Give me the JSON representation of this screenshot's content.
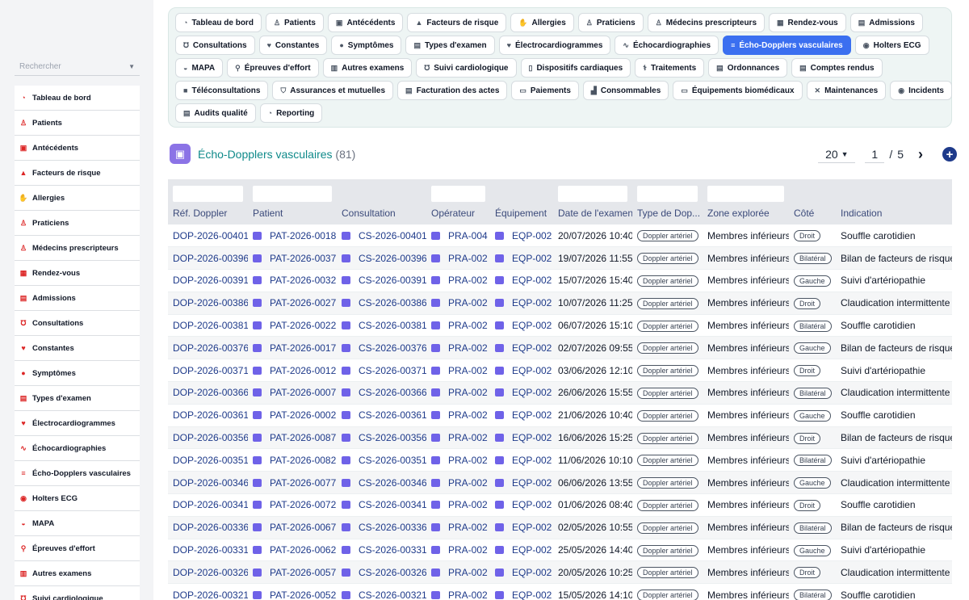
{
  "sidebar": {
    "search_placeholder": "Rechercher",
    "items": [
      {
        "label": "Tableau de bord",
        "icon": "dashboard-icon",
        "glyph": "◔"
      },
      {
        "label": "Patients",
        "icon": "patients-icon",
        "glyph": "♙"
      },
      {
        "label": "Antécédents",
        "icon": "history-icon",
        "glyph": "▣"
      },
      {
        "label": "Facteurs de risque",
        "icon": "warning-icon",
        "glyph": "▲"
      },
      {
        "label": "Allergies",
        "icon": "hand-icon",
        "glyph": "✋"
      },
      {
        "label": "Praticiens",
        "icon": "doctor-icon",
        "glyph": "♙"
      },
      {
        "label": "Médecins prescripteurs",
        "icon": "prescriber-icon",
        "glyph": "♙"
      },
      {
        "label": "Rendez-vous",
        "icon": "calendar-icon",
        "glyph": "▦"
      },
      {
        "label": "Admissions",
        "icon": "clipboard-icon",
        "glyph": "▤"
      },
      {
        "label": "Consultations",
        "icon": "stethoscope-icon",
        "glyph": "℧"
      },
      {
        "label": "Constantes",
        "icon": "heart-pulse-icon",
        "glyph": "♥"
      },
      {
        "label": "Symptômes",
        "icon": "head-icon",
        "glyph": "●"
      },
      {
        "label": "Types d'examen",
        "icon": "list-icon",
        "glyph": "▤"
      },
      {
        "label": "Électrocardiogrammes",
        "icon": "heart-icon",
        "glyph": "♥"
      },
      {
        "label": "Échocardiographies",
        "icon": "wave-icon",
        "glyph": "∿"
      },
      {
        "label": "Écho-Dopplers vasculaires",
        "icon": "lines-icon",
        "glyph": "≡"
      },
      {
        "label": "Holters ECG",
        "icon": "clock-icon",
        "glyph": "◉"
      },
      {
        "label": "MAPA",
        "icon": "gauge-icon",
        "glyph": "◒"
      },
      {
        "label": "Épreuves d'effort",
        "icon": "running-icon",
        "glyph": "⚲"
      },
      {
        "label": "Autres examens",
        "icon": "grid-icon",
        "glyph": "▥"
      },
      {
        "label": "Suivi cardiologique",
        "icon": "stethoscope-icon",
        "glyph": "℧"
      }
    ]
  },
  "topnav": {
    "rows": [
      [
        {
          "label": "Tableau de bord",
          "icon": "dashboard-icon",
          "glyph": "◔"
        },
        {
          "label": "Patients",
          "icon": "patients-icon",
          "glyph": "♙"
        },
        {
          "label": "Antécédents",
          "icon": "history-icon",
          "glyph": "▣"
        },
        {
          "label": "Facteurs de risque",
          "icon": "warning-icon",
          "glyph": "▲"
        },
        {
          "label": "Allergies",
          "icon": "hand-icon",
          "glyph": "✋"
        },
        {
          "label": "Praticiens",
          "icon": "doctor-icon",
          "glyph": "♙"
        },
        {
          "label": "Médecins prescripteurs",
          "icon": "prescriber-icon",
          "glyph": "♙"
        },
        {
          "label": "Rendez-vous",
          "icon": "calendar-icon",
          "glyph": "▦"
        },
        {
          "label": "Admissions",
          "icon": "clipboard-icon",
          "glyph": "▤"
        }
      ],
      [
        {
          "label": "Consultations",
          "icon": "stethoscope-icon",
          "glyph": "℧"
        },
        {
          "label": "Constantes",
          "icon": "heart-pulse-icon",
          "glyph": "♥"
        },
        {
          "label": "Symptômes",
          "icon": "head-icon",
          "glyph": "●"
        },
        {
          "label": "Types d'examen",
          "icon": "list-icon",
          "glyph": "▤"
        },
        {
          "label": "Électrocardiogrammes",
          "icon": "heart-icon",
          "glyph": "♥"
        },
        {
          "label": "Échocardiographies",
          "icon": "wave-icon",
          "glyph": "∿"
        },
        {
          "label": "Écho-Dopplers vasculaires",
          "icon": "lines-icon",
          "glyph": "≡",
          "active": true
        },
        {
          "label": "Holters ECG",
          "icon": "clock-icon",
          "glyph": "◉"
        }
      ],
      [
        {
          "label": "MAPA",
          "icon": "gauge-icon",
          "glyph": "◒"
        },
        {
          "label": "Épreuves d'effort",
          "icon": "running-icon",
          "glyph": "⚲"
        },
        {
          "label": "Autres examens",
          "icon": "grid-icon",
          "glyph": "▥"
        },
        {
          "label": "Suivi cardiologique",
          "icon": "stethoscope-icon",
          "glyph": "℧"
        },
        {
          "label": "Dispositifs cardiaques",
          "icon": "device-icon",
          "glyph": "▯"
        },
        {
          "label": "Traitements",
          "icon": "pills-icon",
          "glyph": "⚕"
        },
        {
          "label": "Ordonnances",
          "icon": "document-icon",
          "glyph": "▤"
        },
        {
          "label": "Comptes rendus",
          "icon": "document-icon",
          "glyph": "▤"
        }
      ],
      [
        {
          "label": "Téléconsultations",
          "icon": "video-icon",
          "glyph": "■"
        },
        {
          "label": "Assurances et mutuelles",
          "icon": "shield-icon",
          "glyph": "⛉"
        },
        {
          "label": "Facturation des actes",
          "icon": "invoice-icon",
          "glyph": "▤"
        },
        {
          "label": "Paiements",
          "icon": "credit-card-icon",
          "glyph": "▭"
        },
        {
          "label": "Consommables",
          "icon": "boxes-icon",
          "glyph": "▟"
        },
        {
          "label": "Équipements biomédicaux",
          "icon": "monitor-icon",
          "glyph": "▭"
        },
        {
          "label": "Maintenances",
          "icon": "tools-icon",
          "glyph": "✕"
        },
        {
          "label": "Incidents",
          "icon": "alert-icon",
          "glyph": "◉"
        }
      ],
      [
        {
          "label": "Audits qualité",
          "icon": "audit-icon",
          "glyph": "▤"
        },
        {
          "label": "Reporting",
          "icon": "chart-icon",
          "glyph": "◔"
        }
      ]
    ]
  },
  "header": {
    "title": "Écho-Dopplers vasculaires",
    "count": "(81)",
    "per_page": "20",
    "page": "1",
    "page_sep": "/",
    "total_pages": "5",
    "next_glyph": "›",
    "add_glyph": "+"
  },
  "table": {
    "columns": [
      "Réf. Doppler",
      "Patient",
      "Consultation",
      "Opérateur",
      "Équipement",
      "Date de l'examen",
      "Type de Dop...",
      "Zone explorée",
      "Côté",
      "Indication"
    ],
    "rows": [
      [
        "DOP-2026-00401",
        "PAT-2026-0018",
        "CS-2026-00401",
        "PRA-004",
        "EQP-002",
        "20/07/2026 10:40",
        "Doppler artériel",
        "Membres inférieurs",
        "Droit",
        "Souffle carotidien"
      ],
      [
        "DOP-2026-00396",
        "PAT-2026-0037",
        "CS-2026-00396",
        "PRA-002",
        "EQP-002",
        "19/07/2026 11:55",
        "Doppler artériel",
        "Membres inférieurs",
        "Bilatéral",
        "Bilan de facteurs de risque"
      ],
      [
        "DOP-2026-00391",
        "PAT-2026-0032",
        "CS-2026-00391",
        "PRA-002",
        "EQP-002",
        "15/07/2026 15:40",
        "Doppler artériel",
        "Membres inférieurs",
        "Gauche",
        "Suivi d'artériopathie"
      ],
      [
        "DOP-2026-00386",
        "PAT-2026-0027",
        "CS-2026-00386",
        "PRA-002",
        "EQP-002",
        "10/07/2026 11:25",
        "Doppler artériel",
        "Membres inférieurs",
        "Droit",
        "Claudication intermittente"
      ],
      [
        "DOP-2026-00381",
        "PAT-2026-0022",
        "CS-2026-00381",
        "PRA-002",
        "EQP-002",
        "06/07/2026 15:10",
        "Doppler artériel",
        "Membres inférieurs",
        "Bilatéral",
        "Souffle carotidien"
      ],
      [
        "DOP-2026-00376",
        "PAT-2026-0017",
        "CS-2026-00376",
        "PRA-002",
        "EQP-002",
        "02/07/2026 09:55",
        "Doppler artériel",
        "Membres inférieurs",
        "Gauche",
        "Bilan de facteurs de risque"
      ],
      [
        "DOP-2026-00371",
        "PAT-2026-0012",
        "CS-2026-00371",
        "PRA-002",
        "EQP-002",
        "03/06/2026 12:10",
        "Doppler artériel",
        "Membres inférieurs",
        "Droit",
        "Suivi d'artériopathie"
      ],
      [
        "DOP-2026-00366",
        "PAT-2026-0007",
        "CS-2026-00366",
        "PRA-002",
        "EQP-002",
        "26/06/2026 15:55",
        "Doppler artériel",
        "Membres inférieurs",
        "Bilatéral",
        "Claudication intermittente"
      ],
      [
        "DOP-2026-00361",
        "PAT-2026-0002",
        "CS-2026-00361",
        "PRA-002",
        "EQP-002",
        "21/06/2026 10:40",
        "Doppler artériel",
        "Membres inférieurs",
        "Gauche",
        "Souffle carotidien"
      ],
      [
        "DOP-2026-00356",
        "PAT-2026-0087",
        "CS-2026-00356",
        "PRA-002",
        "EQP-002",
        "16/06/2026 15:25",
        "Doppler artériel",
        "Membres inférieurs",
        "Droit",
        "Bilan de facteurs de risque"
      ],
      [
        "DOP-2026-00351",
        "PAT-2026-0082",
        "CS-2026-00351",
        "PRA-002",
        "EQP-002",
        "11/06/2026 10:10",
        "Doppler artériel",
        "Membres inférieurs",
        "Bilatéral",
        "Suivi d'artériopathie"
      ],
      [
        "DOP-2026-00346",
        "PAT-2026-0077",
        "CS-2026-00346",
        "PRA-002",
        "EQP-002",
        "06/06/2026 13:55",
        "Doppler artériel",
        "Membres inférieurs",
        "Gauche",
        "Claudication intermittente"
      ],
      [
        "DOP-2026-00341",
        "PAT-2026-0072",
        "CS-2026-00341",
        "PRA-002",
        "EQP-002",
        "01/06/2026 08:40",
        "Doppler artériel",
        "Membres inférieurs",
        "Droit",
        "Souffle carotidien"
      ],
      [
        "DOP-2026-00336",
        "PAT-2026-0067",
        "CS-2026-00336",
        "PRA-002",
        "EQP-002",
        "02/05/2026 10:55",
        "Doppler artériel",
        "Membres inférieurs",
        "Bilatéral",
        "Bilan de facteurs de risque"
      ],
      [
        "DOP-2026-00331",
        "PAT-2026-0062",
        "CS-2026-00331",
        "PRA-002",
        "EQP-002",
        "25/05/2026 14:40",
        "Doppler artériel",
        "Membres inférieurs",
        "Gauche",
        "Suivi d'artériopathie"
      ],
      [
        "DOP-2026-00326",
        "PAT-2026-0057",
        "CS-2026-00326",
        "PRA-002",
        "EQP-002",
        "20/05/2026 10:25",
        "Doppler artériel",
        "Membres inférieurs",
        "Droit",
        "Claudication intermittente"
      ],
      [
        "DOP-2026-00321",
        "PAT-2026-0052",
        "CS-2026-00321",
        "PRA-002",
        "EQP-002",
        "15/05/2026 14:10",
        "Doppler artériel",
        "Membres inférieurs",
        "Bilatéral",
        "Souffle carotidien"
      ]
    ]
  },
  "colors": {
    "accent": "#3b6ff0",
    "link": "#1e3a8a",
    "title": "#0f8a8a",
    "sidebar_icon": "#dc2626",
    "ref_icon": "#6f62e8"
  }
}
